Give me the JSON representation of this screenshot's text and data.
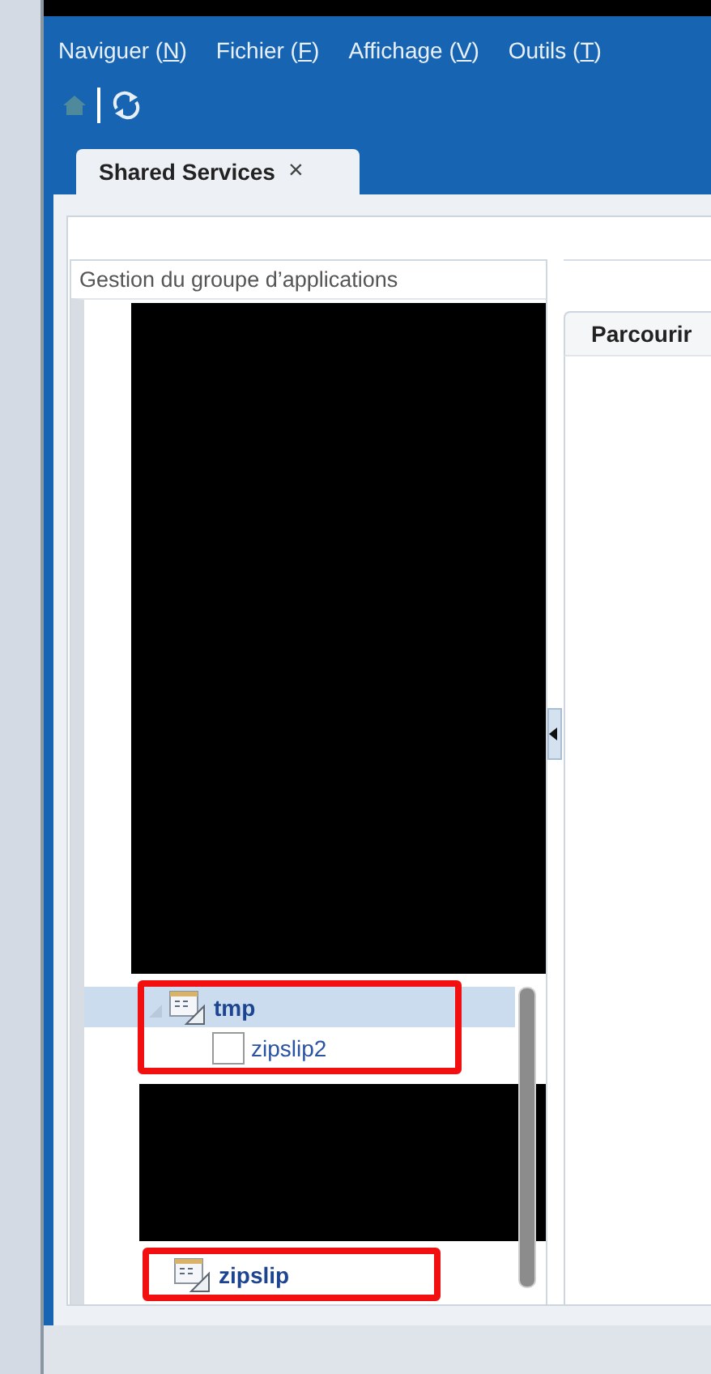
{
  "menu": [
    {
      "before": "Naviguer (",
      "key": "N",
      "after": ")"
    },
    {
      "before": "Fichier (",
      "key": "F",
      "after": ")"
    },
    {
      "before": "Affichage (",
      "key": "V",
      "after": ")"
    },
    {
      "before": "Outils (",
      "key": "T",
      "after": ")"
    }
  ],
  "tabs": [
    {
      "label": "Shared Services",
      "close": "×",
      "selected": true
    }
  ],
  "left_panel": {
    "title": "Gestion du groupe d’applications",
    "tree": [
      {
        "kind": "redacted"
      },
      {
        "kind": "app",
        "label": "tmp",
        "selected": true,
        "expanded": true,
        "highlighted": true,
        "children": [
          {
            "kind": "file",
            "label": "zipslip2",
            "selected": false
          }
        ]
      },
      {
        "kind": "redacted"
      },
      {
        "kind": "app",
        "label": "zipslip",
        "selected": false,
        "highlighted": true
      }
    ]
  },
  "right_panel": {
    "tabs": [
      {
        "label": "Parcourir",
        "selected": true
      }
    ]
  }
}
